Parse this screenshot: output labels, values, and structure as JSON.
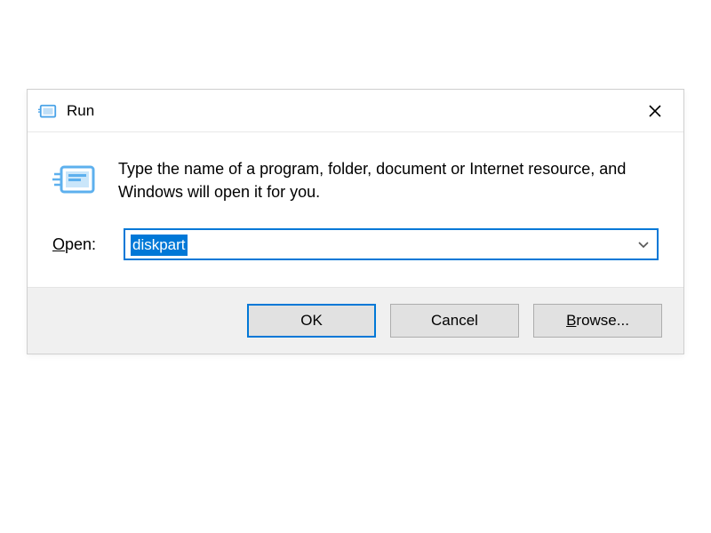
{
  "dialog": {
    "title": "Run",
    "description": "Type the name of a program, folder, document or Internet resource, and Windows will open it for you.",
    "open_label_prefix": "O",
    "open_label_rest": "pen:",
    "input_value": "diskpart",
    "buttons": {
      "ok": "OK",
      "cancel": "Cancel",
      "browse_prefix": "B",
      "browse_rest": "rowse..."
    }
  }
}
